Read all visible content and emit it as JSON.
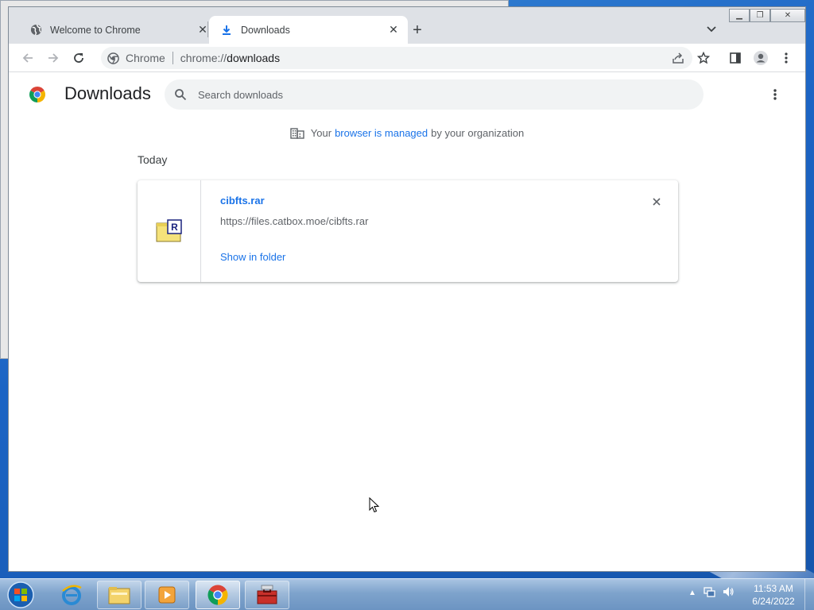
{
  "browser": {
    "tabs": [
      {
        "title": "Welcome to Chrome",
        "icon": "globe-icon",
        "active": false
      },
      {
        "title": "Downloads",
        "icon": "download-icon",
        "active": true
      }
    ],
    "omnibox": {
      "chip_label": "Chrome",
      "url_scheme": "chrome://",
      "url_host": "downloads"
    }
  },
  "downloads_page": {
    "title": "Downloads",
    "search_placeholder": "Search downloads",
    "managed_notice": {
      "prefix": "Your",
      "link": "browser is managed",
      "suffix": "by your organization"
    },
    "section_label": "Today",
    "items": [
      {
        "file_name": "cibfts.rar",
        "url": "https://files.catbox.moe/cibfts.rar",
        "action": "Show in folder",
        "icon": "rar-file-icon"
      }
    ]
  },
  "taskbar": {
    "items": [
      "internet-explorer-icon",
      "file-explorer-icon",
      "media-player-icon",
      "chrome-icon",
      "toolbox-icon"
    ],
    "clock": {
      "time": "11:53 AM",
      "date": "6/24/2022"
    }
  },
  "colors": {
    "link_blue": "#1a73e8",
    "tabstrip": "#dee1e6",
    "taskbar": "#7ea3cc"
  }
}
